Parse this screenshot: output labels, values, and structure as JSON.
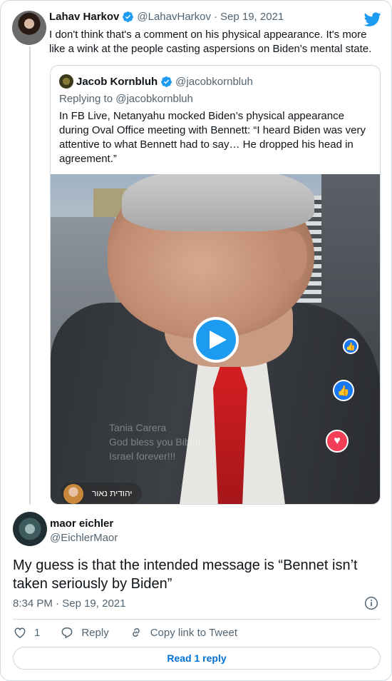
{
  "parent_tweet": {
    "author_name": "Lahav Harkov",
    "author_handle": "@LahavHarkov",
    "separator": "·",
    "date": "Sep 19, 2021",
    "text": "I don't think that's a comment on his physical appearance. It's more like a wink at the people casting aspersions on Biden's mental state."
  },
  "quoted_tweet": {
    "author_name": "Jacob Kornbluh",
    "author_handle": "@jacobkornbluh",
    "replying_to": "Replying to @jacobkornbluh",
    "text": "In FB Live, Netanyahu mocked Biden’s physical appearance during Oval Office meeting with Bennett: “I heard Biden was very attentive to what Bennett had to say… He dropped his head in agreement.”",
    "video": {
      "overlay_comment_line1": "Tania Carera",
      "overlay_comment_line2": "God bless you Bibi!!!",
      "overlay_comment_line3": "Israel forever!!!",
      "commenter_name": "יהודית נאור"
    }
  },
  "reply_tweet": {
    "author_name": "maor eichler",
    "author_handle": "@EichlerMaor",
    "text": "My guess is that the intended message is “Bennet isn’t taken seriously by Biden”",
    "time": "8:34 PM",
    "separator": "·",
    "date": "Sep 19, 2021"
  },
  "actions": {
    "like_count": "1",
    "reply_label": "Reply",
    "copy_label": "Copy link to Tweet"
  },
  "read_replies_label": "Read 1 reply",
  "colors": {
    "twitter_blue": "#1d9bf0",
    "link_blue": "#006fd6",
    "muted_text": "#536471",
    "border": "#cfd9de"
  }
}
